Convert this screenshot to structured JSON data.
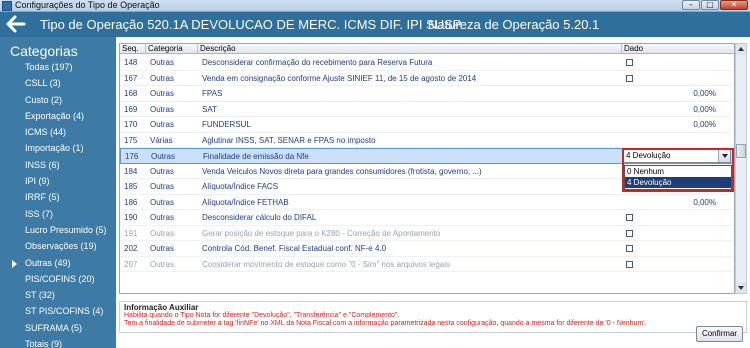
{
  "window": {
    "title": "Configurações do Tipo de Operação",
    "buttons": {
      "minimize": "–",
      "maximize": "□",
      "close": "✕"
    }
  },
  "header": {
    "operation": "Tipo de Operação 520.1A DEVOLUCAO DE MERC. ICMS DIF. IPI SUSP.",
    "nature": "Natureza de Operação 5.20.1"
  },
  "sidebar": {
    "title": "Categorias",
    "items": [
      {
        "label": "Todas (197)"
      },
      {
        "label": "CSLL (3)"
      },
      {
        "label": "Custo (2)"
      },
      {
        "label": "Exportação (4)"
      },
      {
        "label": "ICMS (44)"
      },
      {
        "label": "Importação (1)"
      },
      {
        "label": "INSS (6)"
      },
      {
        "label": "IPI (9)"
      },
      {
        "label": "IRRF (5)"
      },
      {
        "label": "ISS (7)"
      },
      {
        "label": "Lucro Presumido (5)"
      },
      {
        "label": "Observações (19)"
      },
      {
        "label": "Outras (49)",
        "selected": true
      },
      {
        "label": "PIS/COFINS (20)"
      },
      {
        "label": "ST (32)"
      },
      {
        "label": "ST PIS/COFINS (4)"
      },
      {
        "label": "SUFRAMA (5)"
      },
      {
        "label": "Totais (9)"
      }
    ]
  },
  "grid": {
    "columns": {
      "seq": "Seq.",
      "category": "Categoria",
      "description": "Descrição",
      "value": "Dado"
    },
    "rows": [
      {
        "seq": "148",
        "category": "Outras",
        "description": "Desconsiderar confirmação do recebimento para Reserva Futura",
        "type": "checkbox",
        "value": ""
      },
      {
        "seq": "167",
        "category": "Outras",
        "description": "Venda em consignação conforme Ajuste SINIEF 11, de 15 de agosto de 2014",
        "type": "checkbox",
        "value": ""
      },
      {
        "seq": "168",
        "category": "Outras",
        "description": "FPAS",
        "type": "text",
        "value": "0,00%"
      },
      {
        "seq": "169",
        "category": "Outras",
        "description": "SAT",
        "type": "text",
        "value": "0,00%"
      },
      {
        "seq": "170",
        "category": "Outras",
        "description": "FUNDERSUL",
        "type": "text",
        "value": "0,00%"
      },
      {
        "seq": "175",
        "category": "Várias",
        "description": "Aglutinar INSS, SAT, SENAR e FPAS no imposto",
        "type": "none",
        "value": ""
      },
      {
        "seq": "176",
        "category": "Outras",
        "description": "Finalidade de emissão da Nfe",
        "type": "combo",
        "value": "4  Devolução",
        "selected": true
      },
      {
        "seq": "184",
        "category": "Outras",
        "description": "Venda Veículos Novos direta para grandes consumidores (frotista, governo, ...)",
        "type": "none",
        "value": ""
      },
      {
        "seq": "185",
        "category": "Outras",
        "description": "Alíquota/Índice FACS",
        "type": "text",
        "value": "0,00%"
      },
      {
        "seq": "186",
        "category": "Outras",
        "description": "Alíquota/Índice FETHAB",
        "type": "text",
        "value": "0,00%"
      },
      {
        "seq": "190",
        "category": "Outras",
        "description": "Desconsiderar cálculo do DIFAL",
        "type": "checkbox",
        "value": ""
      },
      {
        "seq": "191",
        "category": "Outras",
        "description": "Gerar posição de estoque para o K280 - Correção de Apontamento",
        "type": "checkbox",
        "value": "",
        "disabled": true
      },
      {
        "seq": "202",
        "category": "Outras",
        "description": "Controla Cód. Benef. Fiscal Estadual conf. NF-e 4.0",
        "type": "checkbox",
        "value": ""
      },
      {
        "seq": "207",
        "category": "Outras",
        "description": "Considerar movimento de estoque como \"0 - Sim\" nos arquivos legais",
        "type": "checkbox",
        "value": "",
        "disabled": true
      }
    ],
    "dropdown_options": [
      "0  Nenhum",
      "4  Devolução"
    ]
  },
  "info": {
    "title": "Informação Auxiliar",
    "line1": "Habilita quando o Tipo Nota for diferente \"Devolução\", \"Transferência\" e \"Complemento\".",
    "line2": "Tem a finalidade de submeter a tag 'finNFe' no XML da Nota Fiscal com a informação parametrizada nesta configuração, quando a mesma for diferente de '0 - Nenhum'."
  },
  "confirm_button": "Confirmar",
  "colors": {
    "header_bg": "#2f6f9c",
    "sidebar_bg": "#3d7ba6",
    "row_text": "#1f3d8a",
    "info_text": "#d2261f",
    "highlight": "#c8262b"
  }
}
